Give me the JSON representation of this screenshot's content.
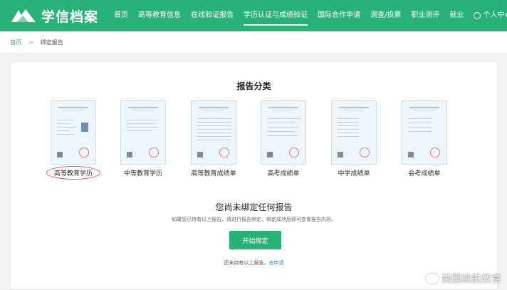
{
  "header": {
    "logo_text": "学信档案",
    "nav": [
      {
        "label": "首页"
      },
      {
        "label": "高等教育信息"
      },
      {
        "label": "在线验证报告"
      },
      {
        "label": "学历认证与成绩验证"
      },
      {
        "label": "国际合作申请"
      },
      {
        "label": "调查/投票"
      },
      {
        "label": "职业测评"
      },
      {
        "label": "就业"
      }
    ],
    "user_label": "个人中心"
  },
  "breadcrumb": {
    "home": "首页",
    "current": "绑定报告"
  },
  "main": {
    "section_title": "报告分类",
    "cards": [
      {
        "label": "高等教育学历"
      },
      {
        "label": "中等教育学历"
      },
      {
        "label": "高等教育成绩单"
      },
      {
        "label": "高考成绩单"
      },
      {
        "label": "中学成绩单"
      },
      {
        "label": "会考成绩单"
      }
    ],
    "empty_title": "您尚未绑定任何报告",
    "empty_desc": "如果您已持有以上报告，请进行报告绑定，绑定成功后即可查看报告内容。",
    "bind_button": "开始绑定",
    "foot_text": "还未持有以上报告，",
    "apply_link": "去申请"
  },
  "watermark": "美国续航教育",
  "colors": {
    "brand": "#29b278",
    "link": "#2a7ae2",
    "highlight": "#d8508a"
  }
}
